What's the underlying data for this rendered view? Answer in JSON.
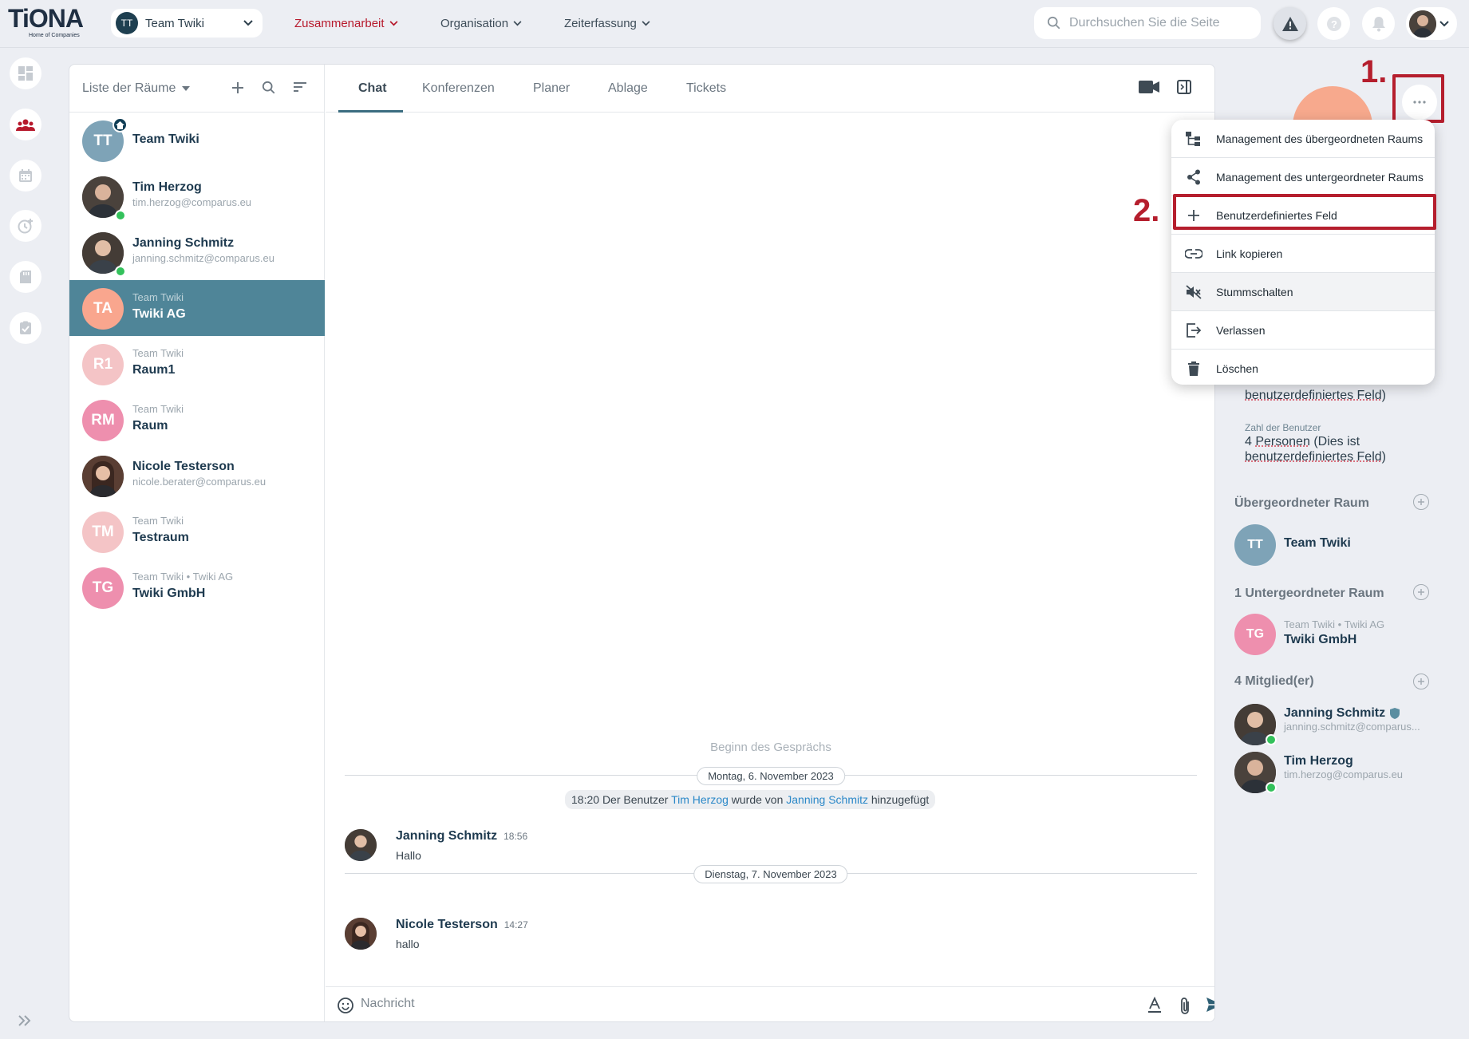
{
  "topbar": {
    "logo_text": "TiONA",
    "logo_sub": "Home of Companies",
    "team_selector": {
      "avatar": "TT",
      "label": "Team Twiki"
    },
    "nav": [
      "Zusammenarbeit",
      "Organisation",
      "Zeiterfassung"
    ],
    "search_placeholder": "Durchsuchen Sie die Seite"
  },
  "sidebar": {
    "icons": [
      "dashboard-icon",
      "team-icon",
      "calendar-icon",
      "time-icon",
      "folder-icon",
      "tasks-icon",
      "expand-icon"
    ]
  },
  "rooms": {
    "header": "Liste der Räume",
    "items": [
      {
        "avatar": "TT",
        "color": "#7ea3b7",
        "sub": "",
        "name": "Team Twiki",
        "home": true
      },
      {
        "avatar": "",
        "color": "#3b3530",
        "sub": "tim.herzog@comparus.eu",
        "name": "Tim Herzog",
        "photo": true,
        "online": true
      },
      {
        "avatar": "",
        "color": "#3b3530",
        "sub": "janning.schmitz@comparus.eu",
        "name": "Janning Schmitz",
        "photo": true,
        "online": true
      },
      {
        "avatar": "TA",
        "color": "#f9a68e",
        "sub": "Team Twiki",
        "name": "Twiki AG",
        "selected": true
      },
      {
        "avatar": "R1",
        "color": "#f4c4c6",
        "sub": "Team Twiki",
        "name": "Raum1"
      },
      {
        "avatar": "RM",
        "color": "#ee8fae",
        "sub": "Team Twiki",
        "name": "Raum"
      },
      {
        "avatar": "",
        "color": "#3b2b25",
        "sub": "nicole.berater@comparus.eu",
        "name": "Nicole Testerson",
        "photo": true
      },
      {
        "avatar": "TM",
        "color": "#f4c4c6",
        "sub": "Team Twiki",
        "name": "Testraum"
      },
      {
        "avatar": "TG",
        "color": "#ee8fae",
        "sub": "Team Twiki • Twiki AG",
        "name": "Twiki GmbH"
      }
    ]
  },
  "tabs": [
    "Chat",
    "Konferenzen",
    "Planer",
    "Ablage",
    "Tickets"
  ],
  "chat": {
    "begin": "Beginn des Gesprächs",
    "date1": "Montag, 6. November 2023",
    "system": {
      "time": "18:20",
      "pre": "Der Benutzer",
      "user1": "Tim Herzog",
      "mid": "wurde von",
      "user2": "Janning Schmitz",
      "post": "hinzugefügt"
    },
    "msg1": {
      "name": "Janning Schmitz",
      "time": "18:56",
      "text": "Hallo"
    },
    "date2": "Dienstag, 7. November 2023",
    "msg2": {
      "name": "Nicole Testerson",
      "time": "14:27",
      "text": "hallo"
    },
    "composer_placeholder": "Nachricht"
  },
  "details": {
    "field1_value_a": "benutzerdefiniertes Feld)",
    "field2_label": "Zahl der Benutzer",
    "field2_value_a": "4",
    "field2_value_b": "Personen",
    "field2_value_c": "(Dies ist",
    "field2_value_d": "benutzerdefiniertes Feld)",
    "parent_title": "Übergeordneter Raum",
    "parent": {
      "avatar": "TT",
      "name": "Team Twiki"
    },
    "children_title": "1 Untergeordneter Raum",
    "child": {
      "avatar": "TG",
      "sub": "Team Twiki • Twiki AG",
      "name": "Twiki GmbH"
    },
    "members_title": "4 Mitglied(er)",
    "members": [
      {
        "name": "Janning Schmitz",
        "email": "janning.schmitz@comparus..."
      },
      {
        "name": "Tim Herzog",
        "email": "tim.herzog@comparus.eu"
      }
    ]
  },
  "menu": {
    "items": [
      "Management des übergeordneten Raums",
      "Management des untergeordneter Raums",
      "Benutzerdefiniertes Feld",
      "Link kopieren",
      "Stummschalten",
      "Verlassen",
      "Löschen"
    ]
  },
  "annotations": {
    "step1": "1.",
    "step2": "2."
  },
  "colors": {
    "accent": "#b7192c",
    "selected_room": "#4f8598",
    "highlight": "#b51e2d",
    "online": "#33c15b"
  }
}
